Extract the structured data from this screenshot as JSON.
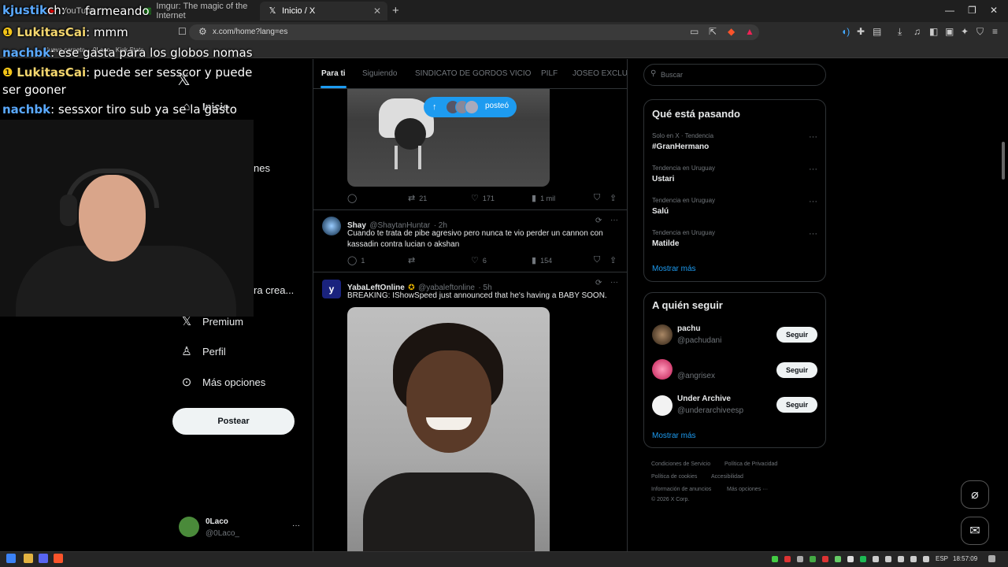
{
  "browser": {
    "tabs": [
      {
        "label": "YouTube",
        "active": false
      },
      {
        "label": "Imgur: The magic of the Internet",
        "active": false
      },
      {
        "label": "Inicio / X",
        "active": true
      }
    ],
    "url": "x.com/home?lang=es",
    "bookmarks": [
      "Nueva carpeta",
      "0Laco - Kick Stats"
    ]
  },
  "nav": {
    "home": "Inicio",
    "partial_item": "nes",
    "partial_item2": "ra crea...",
    "premium": "Premium",
    "profile": "Perfil",
    "more": "Más opciones",
    "post_button": "Postear",
    "user_name": "0Laco",
    "user_handle": "@0Laco_",
    "user_more": "···"
  },
  "feed": {
    "tabs": [
      "Para ti",
      "Siguiendo",
      "SINDICATO DE GORDOS VICIO",
      "PILF",
      "JOSEO EXCLUSI"
    ],
    "posted_pill": "posteó",
    "tweet1": {
      "replies": "",
      "retweets": "21",
      "likes": "171",
      "views": "1 mil"
    },
    "tweet2": {
      "name": "Shay",
      "handle": "@ShaytanHuntar",
      "time": "· 2h",
      "text": "Cuando te trata de pibe agresivo pero nunca te vio perder un cannon con kassadin contra lucian o akshan",
      "replies": "1",
      "retweets": "",
      "likes": "6",
      "views": "154"
    },
    "tweet3": {
      "name": "YabaLeftOnline",
      "handle": "@yabaleftonline",
      "time": "· 5h",
      "text": "BREAKING: IShowSpeed just announced that he's having a BABY SOON."
    }
  },
  "right": {
    "search_placeholder": "Buscar",
    "trends_title": "Qué está pasando",
    "trends": [
      {
        "context": "Solo en X · Tendencia",
        "name": "#GranHermano"
      },
      {
        "context": "Tendencia en Uruguay",
        "name": "Ustari"
      },
      {
        "context": "Tendencia en Uruguay",
        "name": "Salú"
      },
      {
        "context": "Tendencia en Uruguay",
        "name": "Matilde"
      }
    ],
    "show_more": "Mostrar más",
    "follow_title": "A quién seguir",
    "follow": [
      {
        "name": "pachu",
        "handle": "@pachudani",
        "button": "Seguir"
      },
      {
        "name": "",
        "handle": "@angrisex",
        "button": "Seguir"
      },
      {
        "name": "Under Archive",
        "handle": "@underarchiveesp",
        "button": "Seguir"
      }
    ],
    "footer": [
      "Condiciones de Servicio",
      "Política de Privacidad",
      "Política de cookies",
      "Accesibilidad",
      "Información de anuncios",
      "Más opciones ···",
      "© 2026 X Corp."
    ]
  },
  "overlay": {
    "stream_title": "farmeando",
    "chat": [
      {
        "user": "kjustik",
        "msg": "ch:"
      },
      {
        "user": "LukitasCai",
        "msg": ": mmm"
      },
      {
        "user": "nachbk",
        "msg": ": ese gasta para los globos nomas"
      },
      {
        "user": "LukitasCai",
        "msg": ": puede ser sesscor y puede"
      },
      {
        "user": "",
        "msg": "ser gooner"
      },
      {
        "user": "nachbk",
        "msg": ": sessxor tiro sub ya se la gasto"
      }
    ]
  },
  "taskbar": {
    "lang": "ESP",
    "time": "18:57:09"
  },
  "colors": {
    "accent": "#1d9bf0",
    "background": "#000000",
    "border": "#2f3336",
    "muted": "#71767b"
  }
}
